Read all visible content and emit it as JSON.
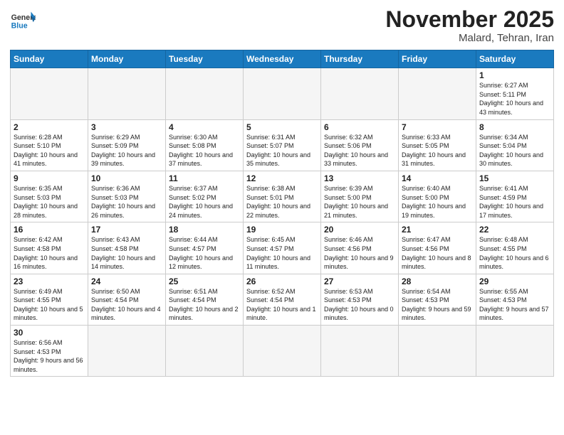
{
  "header": {
    "logo_general": "General",
    "logo_blue": "Blue",
    "month_title": "November 2025",
    "location": "Malard, Tehran, Iran"
  },
  "weekdays": [
    "Sunday",
    "Monday",
    "Tuesday",
    "Wednesday",
    "Thursday",
    "Friday",
    "Saturday"
  ],
  "weeks": [
    [
      {
        "day": "",
        "info": ""
      },
      {
        "day": "",
        "info": ""
      },
      {
        "day": "",
        "info": ""
      },
      {
        "day": "",
        "info": ""
      },
      {
        "day": "",
        "info": ""
      },
      {
        "day": "",
        "info": ""
      },
      {
        "day": "1",
        "info": "Sunrise: 6:27 AM\nSunset: 5:11 PM\nDaylight: 10 hours\nand 43 minutes."
      }
    ],
    [
      {
        "day": "2",
        "info": "Sunrise: 6:28 AM\nSunset: 5:10 PM\nDaylight: 10 hours\nand 41 minutes."
      },
      {
        "day": "3",
        "info": "Sunrise: 6:29 AM\nSunset: 5:09 PM\nDaylight: 10 hours\nand 39 minutes."
      },
      {
        "day": "4",
        "info": "Sunrise: 6:30 AM\nSunset: 5:08 PM\nDaylight: 10 hours\nand 37 minutes."
      },
      {
        "day": "5",
        "info": "Sunrise: 6:31 AM\nSunset: 5:07 PM\nDaylight: 10 hours\nand 35 minutes."
      },
      {
        "day": "6",
        "info": "Sunrise: 6:32 AM\nSunset: 5:06 PM\nDaylight: 10 hours\nand 33 minutes."
      },
      {
        "day": "7",
        "info": "Sunrise: 6:33 AM\nSunset: 5:05 PM\nDaylight: 10 hours\nand 31 minutes."
      },
      {
        "day": "8",
        "info": "Sunrise: 6:34 AM\nSunset: 5:04 PM\nDaylight: 10 hours\nand 30 minutes."
      }
    ],
    [
      {
        "day": "9",
        "info": "Sunrise: 6:35 AM\nSunset: 5:03 PM\nDaylight: 10 hours\nand 28 minutes."
      },
      {
        "day": "10",
        "info": "Sunrise: 6:36 AM\nSunset: 5:03 PM\nDaylight: 10 hours\nand 26 minutes."
      },
      {
        "day": "11",
        "info": "Sunrise: 6:37 AM\nSunset: 5:02 PM\nDaylight: 10 hours\nand 24 minutes."
      },
      {
        "day": "12",
        "info": "Sunrise: 6:38 AM\nSunset: 5:01 PM\nDaylight: 10 hours\nand 22 minutes."
      },
      {
        "day": "13",
        "info": "Sunrise: 6:39 AM\nSunset: 5:00 PM\nDaylight: 10 hours\nand 21 minutes."
      },
      {
        "day": "14",
        "info": "Sunrise: 6:40 AM\nSunset: 5:00 PM\nDaylight: 10 hours\nand 19 minutes."
      },
      {
        "day": "15",
        "info": "Sunrise: 6:41 AM\nSunset: 4:59 PM\nDaylight: 10 hours\nand 17 minutes."
      }
    ],
    [
      {
        "day": "16",
        "info": "Sunrise: 6:42 AM\nSunset: 4:58 PM\nDaylight: 10 hours\nand 16 minutes."
      },
      {
        "day": "17",
        "info": "Sunrise: 6:43 AM\nSunset: 4:58 PM\nDaylight: 10 hours\nand 14 minutes."
      },
      {
        "day": "18",
        "info": "Sunrise: 6:44 AM\nSunset: 4:57 PM\nDaylight: 10 hours\nand 12 minutes."
      },
      {
        "day": "19",
        "info": "Sunrise: 6:45 AM\nSunset: 4:57 PM\nDaylight: 10 hours\nand 11 minutes."
      },
      {
        "day": "20",
        "info": "Sunrise: 6:46 AM\nSunset: 4:56 PM\nDaylight: 10 hours\nand 9 minutes."
      },
      {
        "day": "21",
        "info": "Sunrise: 6:47 AM\nSunset: 4:56 PM\nDaylight: 10 hours\nand 8 minutes."
      },
      {
        "day": "22",
        "info": "Sunrise: 6:48 AM\nSunset: 4:55 PM\nDaylight: 10 hours\nand 6 minutes."
      }
    ],
    [
      {
        "day": "23",
        "info": "Sunrise: 6:49 AM\nSunset: 4:55 PM\nDaylight: 10 hours\nand 5 minutes."
      },
      {
        "day": "24",
        "info": "Sunrise: 6:50 AM\nSunset: 4:54 PM\nDaylight: 10 hours\nand 4 minutes."
      },
      {
        "day": "25",
        "info": "Sunrise: 6:51 AM\nSunset: 4:54 PM\nDaylight: 10 hours\nand 2 minutes."
      },
      {
        "day": "26",
        "info": "Sunrise: 6:52 AM\nSunset: 4:54 PM\nDaylight: 10 hours\nand 1 minute."
      },
      {
        "day": "27",
        "info": "Sunrise: 6:53 AM\nSunset: 4:53 PM\nDaylight: 10 hours\nand 0 minutes."
      },
      {
        "day": "28",
        "info": "Sunrise: 6:54 AM\nSunset: 4:53 PM\nDaylight: 9 hours\nand 59 minutes."
      },
      {
        "day": "29",
        "info": "Sunrise: 6:55 AM\nSunset: 4:53 PM\nDaylight: 9 hours\nand 57 minutes."
      }
    ],
    [
      {
        "day": "30",
        "info": "Sunrise: 6:56 AM\nSunset: 4:53 PM\nDaylight: 9 hours\nand 56 minutes."
      },
      {
        "day": "",
        "info": ""
      },
      {
        "day": "",
        "info": ""
      },
      {
        "day": "",
        "info": ""
      },
      {
        "day": "",
        "info": ""
      },
      {
        "day": "",
        "info": ""
      },
      {
        "day": "",
        "info": ""
      }
    ]
  ]
}
